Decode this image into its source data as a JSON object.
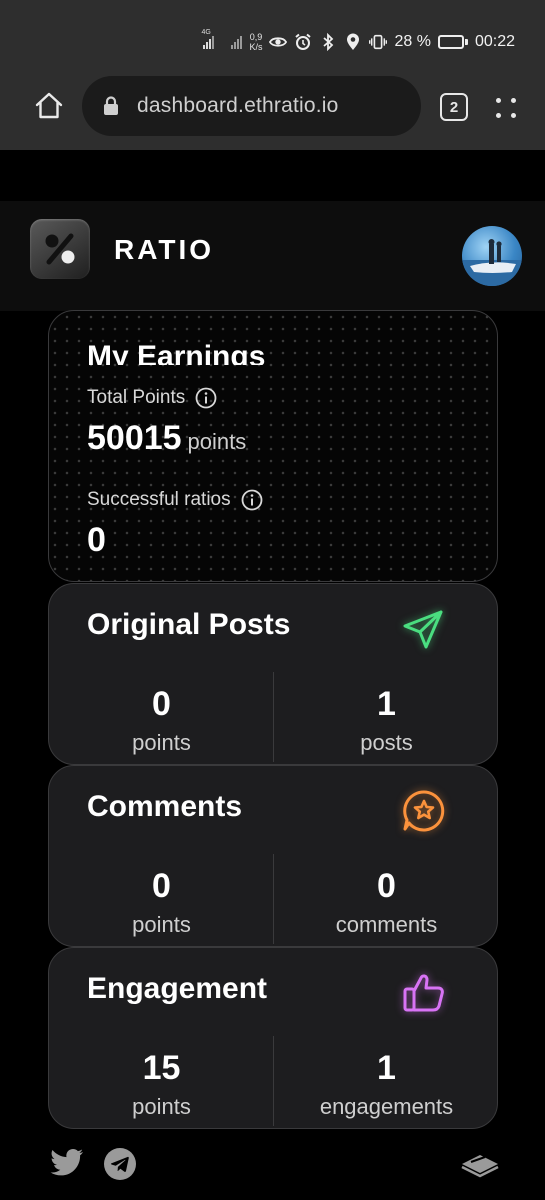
{
  "status_bar": {
    "network_tag": "4G",
    "speed_value": "0,9",
    "speed_unit": "K/s",
    "battery_percent": "28 %",
    "battery_level": 0.28,
    "time": "00:22",
    "icons": [
      "signal-icon",
      "signal-icon",
      "eye-icon",
      "alarm-icon",
      "bluetooth-icon",
      "location-icon",
      "vibrate-icon",
      "battery-icon"
    ]
  },
  "browser": {
    "url": "dashboard.ethratio.io",
    "tab_count": "2",
    "icons": [
      "home-icon",
      "lock-icon",
      "tabs-icon",
      "menu-icon"
    ]
  },
  "header": {
    "brand": "RATIO",
    "logo_icon": "percent-icon",
    "avatar_icon": "avatar"
  },
  "earnings": {
    "title": "My Earnings",
    "total_points_label": "Total Points",
    "total_points_value": "50015",
    "total_points_unit": "points",
    "successful_ratios_label": "Successful ratios",
    "successful_ratios_value": "0"
  },
  "original_posts": {
    "title": "Original Posts",
    "icon": "paper-plane-icon",
    "accent": "#4ade80",
    "points_value": "0",
    "points_label": "points",
    "count_value": "1",
    "count_label": "posts"
  },
  "comments": {
    "title": "Comments",
    "icon": "chat-star-icon",
    "accent": "#fb923c",
    "points_value": "0",
    "points_label": "points",
    "count_value": "0",
    "count_label": "comments"
  },
  "engagement": {
    "title": "Engagement",
    "icon": "thumbs-up-icon",
    "accent": "#d873f5",
    "points_value": "15",
    "points_label": "points",
    "count_value": "1",
    "count_label": "engagements"
  },
  "footer": {
    "icons": [
      "twitter-icon",
      "telegram-icon",
      "gitbook-icon"
    ]
  }
}
